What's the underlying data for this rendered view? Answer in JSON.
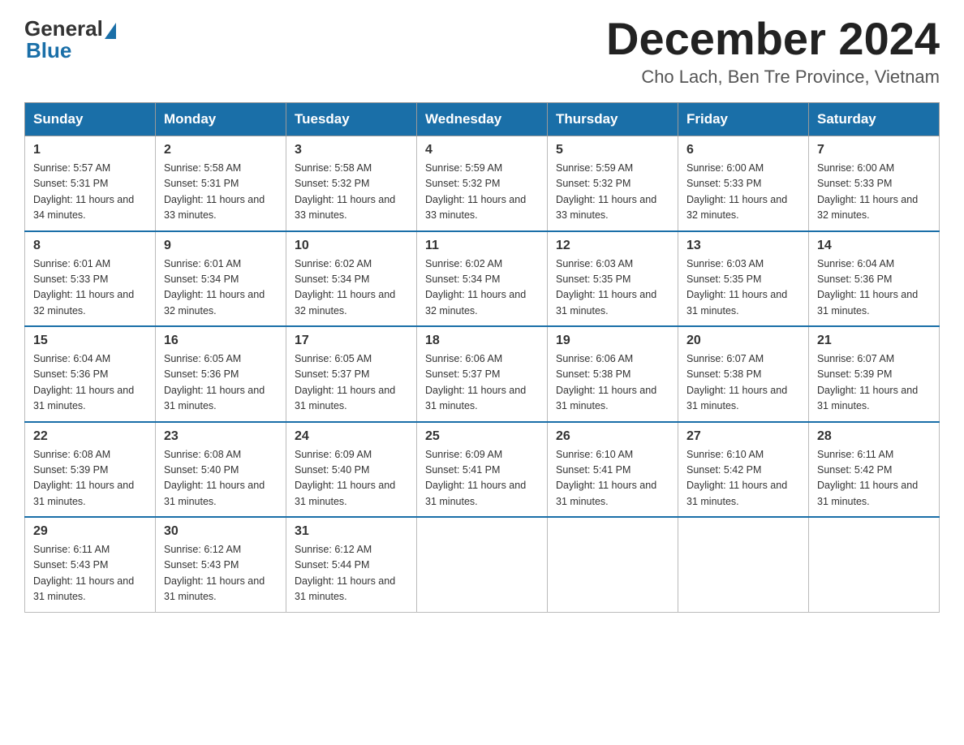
{
  "header": {
    "logo_general": "General",
    "logo_blue": "Blue",
    "month_title": "December 2024",
    "location": "Cho Lach, Ben Tre Province, Vietnam"
  },
  "days_of_week": [
    "Sunday",
    "Monday",
    "Tuesday",
    "Wednesday",
    "Thursday",
    "Friday",
    "Saturday"
  ],
  "weeks": [
    [
      {
        "day": "1",
        "sunrise": "5:57 AM",
        "sunset": "5:31 PM",
        "daylight": "11 hours and 34 minutes."
      },
      {
        "day": "2",
        "sunrise": "5:58 AM",
        "sunset": "5:31 PM",
        "daylight": "11 hours and 33 minutes."
      },
      {
        "day": "3",
        "sunrise": "5:58 AM",
        "sunset": "5:32 PM",
        "daylight": "11 hours and 33 minutes."
      },
      {
        "day": "4",
        "sunrise": "5:59 AM",
        "sunset": "5:32 PM",
        "daylight": "11 hours and 33 minutes."
      },
      {
        "day": "5",
        "sunrise": "5:59 AM",
        "sunset": "5:32 PM",
        "daylight": "11 hours and 33 minutes."
      },
      {
        "day": "6",
        "sunrise": "6:00 AM",
        "sunset": "5:33 PM",
        "daylight": "11 hours and 32 minutes."
      },
      {
        "day": "7",
        "sunrise": "6:00 AM",
        "sunset": "5:33 PM",
        "daylight": "11 hours and 32 minutes."
      }
    ],
    [
      {
        "day": "8",
        "sunrise": "6:01 AM",
        "sunset": "5:33 PM",
        "daylight": "11 hours and 32 minutes."
      },
      {
        "day": "9",
        "sunrise": "6:01 AM",
        "sunset": "5:34 PM",
        "daylight": "11 hours and 32 minutes."
      },
      {
        "day": "10",
        "sunrise": "6:02 AM",
        "sunset": "5:34 PM",
        "daylight": "11 hours and 32 minutes."
      },
      {
        "day": "11",
        "sunrise": "6:02 AM",
        "sunset": "5:34 PM",
        "daylight": "11 hours and 32 minutes."
      },
      {
        "day": "12",
        "sunrise": "6:03 AM",
        "sunset": "5:35 PM",
        "daylight": "11 hours and 31 minutes."
      },
      {
        "day": "13",
        "sunrise": "6:03 AM",
        "sunset": "5:35 PM",
        "daylight": "11 hours and 31 minutes."
      },
      {
        "day": "14",
        "sunrise": "6:04 AM",
        "sunset": "5:36 PM",
        "daylight": "11 hours and 31 minutes."
      }
    ],
    [
      {
        "day": "15",
        "sunrise": "6:04 AM",
        "sunset": "5:36 PM",
        "daylight": "11 hours and 31 minutes."
      },
      {
        "day": "16",
        "sunrise": "6:05 AM",
        "sunset": "5:36 PM",
        "daylight": "11 hours and 31 minutes."
      },
      {
        "day": "17",
        "sunrise": "6:05 AM",
        "sunset": "5:37 PM",
        "daylight": "11 hours and 31 minutes."
      },
      {
        "day": "18",
        "sunrise": "6:06 AM",
        "sunset": "5:37 PM",
        "daylight": "11 hours and 31 minutes."
      },
      {
        "day": "19",
        "sunrise": "6:06 AM",
        "sunset": "5:38 PM",
        "daylight": "11 hours and 31 minutes."
      },
      {
        "day": "20",
        "sunrise": "6:07 AM",
        "sunset": "5:38 PM",
        "daylight": "11 hours and 31 minutes."
      },
      {
        "day": "21",
        "sunrise": "6:07 AM",
        "sunset": "5:39 PM",
        "daylight": "11 hours and 31 minutes."
      }
    ],
    [
      {
        "day": "22",
        "sunrise": "6:08 AM",
        "sunset": "5:39 PM",
        "daylight": "11 hours and 31 minutes."
      },
      {
        "day": "23",
        "sunrise": "6:08 AM",
        "sunset": "5:40 PM",
        "daylight": "11 hours and 31 minutes."
      },
      {
        "day": "24",
        "sunrise": "6:09 AM",
        "sunset": "5:40 PM",
        "daylight": "11 hours and 31 minutes."
      },
      {
        "day": "25",
        "sunrise": "6:09 AM",
        "sunset": "5:41 PM",
        "daylight": "11 hours and 31 minutes."
      },
      {
        "day": "26",
        "sunrise": "6:10 AM",
        "sunset": "5:41 PM",
        "daylight": "11 hours and 31 minutes."
      },
      {
        "day": "27",
        "sunrise": "6:10 AM",
        "sunset": "5:42 PM",
        "daylight": "11 hours and 31 minutes."
      },
      {
        "day": "28",
        "sunrise": "6:11 AM",
        "sunset": "5:42 PM",
        "daylight": "11 hours and 31 minutes."
      }
    ],
    [
      {
        "day": "29",
        "sunrise": "6:11 AM",
        "sunset": "5:43 PM",
        "daylight": "11 hours and 31 minutes."
      },
      {
        "day": "30",
        "sunrise": "6:12 AM",
        "sunset": "5:43 PM",
        "daylight": "11 hours and 31 minutes."
      },
      {
        "day": "31",
        "sunrise": "6:12 AM",
        "sunset": "5:44 PM",
        "daylight": "11 hours and 31 minutes."
      },
      null,
      null,
      null,
      null
    ]
  ],
  "labels": {
    "sunrise": "Sunrise:",
    "sunset": "Sunset:",
    "daylight": "Daylight:"
  }
}
